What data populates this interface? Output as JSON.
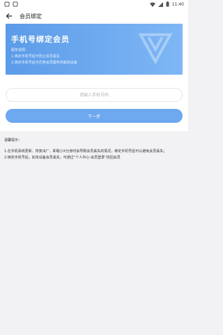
{
  "status_bar": {
    "time": "11:40",
    "left_icons": [
      "app-icon",
      "app-icon"
    ],
    "right_icons": [
      "wifi-icon",
      "signal-icon",
      "battery-icon"
    ]
  },
  "app_bar": {
    "title": "会员绑定"
  },
  "banner": {
    "title": "手机号绑定会员",
    "desc_heading": "服务说明：",
    "desc_lines": [
      "1.绑定手机号后可防止会员丢失",
      "2.绑定手机号后可迁移会员服务到其他设备"
    ]
  },
  "form": {
    "phone_placeholder": "请输入手机号码",
    "next_label": "下一步"
  },
  "tips": {
    "heading": "温馨提示：",
    "lines": [
      "1.在手机系统更新、恢复出厂、卸载小X分身时会导致会员丢失的情况，绑定手机号后可以避免会员丢失；",
      "2.绑定手机号后，如本设备会员丢失，可通过“个人中心-会员登录”找回会员"
    ]
  },
  "colors": {
    "banner_start": "#5b9be8",
    "banner_end": "#7fb7f5",
    "button": "#6ea8ee"
  }
}
